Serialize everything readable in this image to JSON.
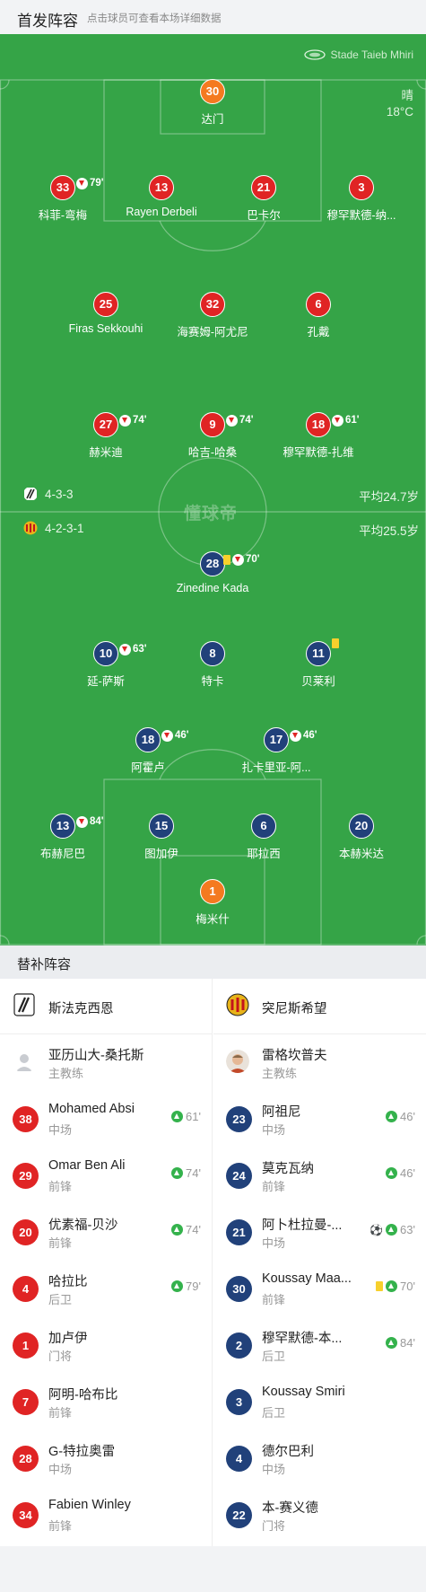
{
  "header": {
    "title": "首发阵容",
    "hint": "点击球员可查看本场详细数据"
  },
  "match": {
    "venue": "Stade Taieb Mhiri",
    "weather": "晴",
    "temperature": "18°C",
    "watermark": "懂球帝"
  },
  "home_team": {
    "name": "斯法克西恩",
    "formation": "4-3-3",
    "avg_age": "平均24.7岁",
    "goalkeeper": {
      "number": "30",
      "name": "达门"
    },
    "defenders": [
      {
        "number": "33",
        "name": "科菲-弯梅",
        "sub_min": "79'"
      },
      {
        "number": "13",
        "name": "Rayen Derbeli"
      },
      {
        "number": "21",
        "name": "巴卡尔"
      },
      {
        "number": "3",
        "name": "穆罕默德-纳..."
      }
    ],
    "midfielders": [
      {
        "number": "25",
        "name": "Firas Sekkouhi"
      },
      {
        "number": "32",
        "name": "海赛姆-阿尤尼"
      },
      {
        "number": "6",
        "name": "孔戴"
      }
    ],
    "forwards": [
      {
        "number": "27",
        "name": "赫米迪",
        "sub_min": "74'"
      },
      {
        "number": "9",
        "name": "哈吉-哈桑",
        "sub_min": "74'"
      },
      {
        "number": "18",
        "name": "穆罕默德-扎维",
        "sub_min": "61'"
      }
    ]
  },
  "away_team": {
    "name": "突尼斯希望",
    "formation": "4-2-3-1",
    "avg_age": "平均25.5岁",
    "striker": {
      "number": "28",
      "name": "Zinedine Kada",
      "sub_min": "70'"
    },
    "attacking_mid": [
      {
        "number": "10",
        "name": "延-萨斯",
        "sub_min": "63'"
      },
      {
        "number": "8",
        "name": "特卡"
      },
      {
        "number": "11",
        "name": "贝莱利"
      }
    ],
    "defensive_mid": [
      {
        "number": "18",
        "name": "阿霍卢",
        "sub_min": "46'"
      },
      {
        "number": "17",
        "name": "扎卡里亚-阿...",
        "sub_min": "46'"
      }
    ],
    "defenders": [
      {
        "number": "13",
        "name": "布赫尼巴",
        "sub_min": "84'"
      },
      {
        "number": "15",
        "name": "图加伊"
      },
      {
        "number": "6",
        "name": "耶拉西"
      },
      {
        "number": "20",
        "name": "本赫米达"
      }
    ],
    "goalkeeper": {
      "number": "1",
      "name": "梅米什"
    }
  },
  "subs_section": {
    "title": "替补阵容",
    "home": {
      "team_name": "斯法克西恩",
      "coach": {
        "name": "亚历山大-桑托斯",
        "role": "主教练"
      },
      "players": [
        {
          "number": "38",
          "name": "Mohamed Absi",
          "position": "中场",
          "in_min": "61'"
        },
        {
          "number": "29",
          "name": "Omar Ben Ali",
          "position": "前锋",
          "in_min": "74'"
        },
        {
          "number": "20",
          "name": "优素福-贝沙",
          "position": "前锋",
          "in_min": "74'"
        },
        {
          "number": "4",
          "name": "哈拉比",
          "position": "后卫",
          "in_min": "79'"
        },
        {
          "number": "1",
          "name": "加卢伊",
          "position": "门将"
        },
        {
          "number": "7",
          "name": "阿明-哈布比",
          "position": "前锋"
        },
        {
          "number": "28",
          "name": "G-特拉奥雷",
          "position": "中场"
        },
        {
          "number": "34",
          "name": "Fabien Winley",
          "position": "前锋"
        }
      ]
    },
    "away": {
      "team_name": "突尼斯希望",
      "coach": {
        "name": "雷格坎普夫",
        "role": "主教练"
      },
      "players": [
        {
          "number": "23",
          "name": "阿祖尼",
          "position": "中场",
          "in_min": "46'"
        },
        {
          "number": "24",
          "name": "莫克瓦纳",
          "position": "前锋",
          "in_min": "46'"
        },
        {
          "number": "21",
          "name": "阿卜杜拉曼-...",
          "position": "中场",
          "in_min": "63'"
        },
        {
          "number": "30",
          "name": "Koussay Maa...",
          "position": "前锋",
          "in_min": "70'"
        },
        {
          "number": "2",
          "name": "穆罕默德-本...",
          "position": "后卫",
          "in_min": "84'"
        },
        {
          "number": "3",
          "name": "Koussay Smiri",
          "position": "后卫"
        },
        {
          "number": "4",
          "name": "德尔巴利",
          "position": "中场"
        },
        {
          "number": "22",
          "name": "本-赛义德",
          "position": "门将"
        }
      ]
    }
  },
  "colors": {
    "home": "#e02424",
    "away": "#21417a",
    "goalkeeper": "#f47a20",
    "pitch": "#35a447"
  },
  "icons": {
    "sub_out": "sub-out-icon",
    "sub_in": "sub-in-icon",
    "yellow_card": "yellow-card-icon",
    "goal": "goal-ball-icon"
  }
}
